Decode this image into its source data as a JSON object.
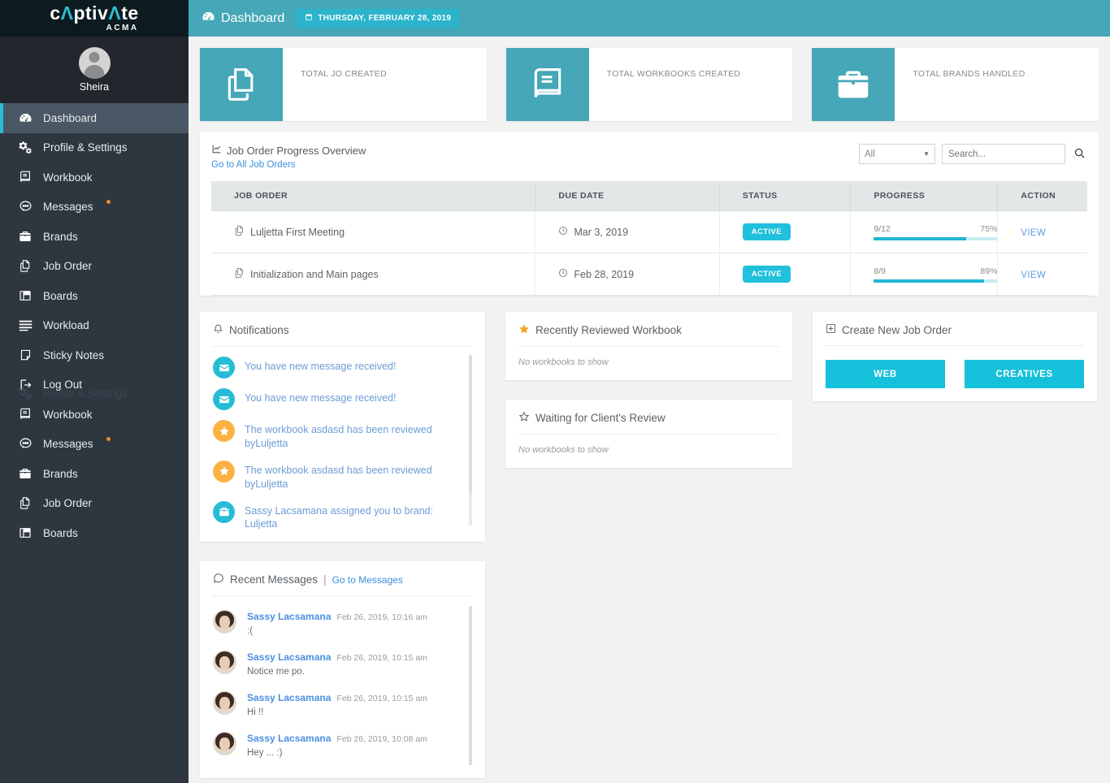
{
  "brand": {
    "name_part1": "c",
    "name_accent": "Ʌ",
    "name_part2": "ptiv",
    "name_accent2": "Ʌ",
    "name_part3": "te",
    "full": "captivate",
    "sub": "ACMA"
  },
  "profile": {
    "name": "Sheira"
  },
  "sidebar": {
    "items": [
      {
        "label": "Dashboard",
        "icon": "dashboard-icon",
        "active": true,
        "dot": false
      },
      {
        "label": "Profile & Settings",
        "icon": "gears-icon",
        "active": false,
        "dot": false
      },
      {
        "label": "Workbook",
        "icon": "book-icon",
        "active": false,
        "dot": false
      },
      {
        "label": "Messages",
        "icon": "chat-icon",
        "active": false,
        "dot": true
      },
      {
        "label": "Brands",
        "icon": "briefcase-icon",
        "active": false,
        "dot": false
      },
      {
        "label": "Job Order",
        "icon": "copy-icon",
        "active": false,
        "dot": false
      },
      {
        "label": "Boards",
        "icon": "columns-icon",
        "active": false,
        "dot": false
      },
      {
        "label": "Workload",
        "icon": "bars-icon",
        "active": false,
        "dot": false
      },
      {
        "label": "Sticky Notes",
        "icon": "note-icon",
        "active": false,
        "dot": false
      },
      {
        "label": "Log Out",
        "icon": "logout-icon",
        "active": false,
        "dot": false
      },
      {
        "label": "Workbook",
        "icon": "book-icon",
        "active": false,
        "dot": false
      },
      {
        "label": "Messages",
        "icon": "chat-icon",
        "active": false,
        "dot": true
      },
      {
        "label": "Brands",
        "icon": "briefcase-icon",
        "active": false,
        "dot": false
      },
      {
        "label": "Job Order",
        "icon": "copy-icon",
        "active": false,
        "dot": false
      },
      {
        "label": "Boards",
        "icon": "columns-icon",
        "active": false,
        "dot": false
      }
    ],
    "ghost_label": "Profile & Settings"
  },
  "topbar": {
    "title": "Dashboard",
    "title_icon": "dashboard-icon",
    "date": "THURSDAY, FEBRUARY 28, 2019",
    "date_icon": "calendar-icon"
  },
  "stats": [
    {
      "label": "TOTAL JO CREATED",
      "value": "",
      "icon": "copy-icon"
    },
    {
      "label": "TOTAL WORKBOOKS CREATED",
      "value": "",
      "icon": "book-icon"
    },
    {
      "label": "TOTAL BRANDS HANDLED",
      "value": "",
      "icon": "briefcase-icon"
    }
  ],
  "job_orders": {
    "title": "Job Order Progress Overview",
    "title_icon": "chart-line-icon",
    "link": "Go to All Job Orders",
    "filter_value": "All",
    "search_placeholder": "Search...",
    "search_value": "",
    "columns": [
      "JOB ORDER",
      "DUE DATE",
      "STATUS",
      "PROGRESS",
      "ACTION"
    ],
    "rows": [
      {
        "name": "Luljetta First Meeting",
        "due": "Mar 3, 2019",
        "status": "ACTIVE",
        "ratio": "9/12",
        "percent": "75%",
        "percent_num": 75,
        "action": "VIEW"
      },
      {
        "name": "Initialization and Main pages",
        "due": "Feb 28, 2019",
        "status": "ACTIVE",
        "ratio": "8/9",
        "percent": "89%",
        "percent_num": 89,
        "action": "VIEW"
      }
    ]
  },
  "notifications": {
    "title": "Notifications",
    "title_icon": "bell-icon",
    "items": [
      {
        "text": "You have new message received!",
        "icon": "envelope-icon",
        "style": "msg"
      },
      {
        "text": "You have new message received!",
        "icon": "envelope-icon",
        "style": "msg"
      },
      {
        "text": "The workbook asdasd has been reviewed byLuljetta",
        "icon": "star-icon",
        "style": "star"
      },
      {
        "text": "The workbook asdasd has been reviewed byLuljetta",
        "icon": "star-icon",
        "style": "star"
      },
      {
        "text": "Sassy Lacsamana assigned you to brand: Luljetta",
        "icon": "briefcase-icon",
        "style": "brand"
      }
    ]
  },
  "reviewed": {
    "title": "Recently Reviewed Workbook",
    "title_icon": "star-filled-icon",
    "empty": "No workbooks to show"
  },
  "waiting": {
    "title": "Waiting for Client's Review",
    "title_icon": "star-outline-icon",
    "empty": "No workbooks to show"
  },
  "create_jo": {
    "title": "Create New Job Order",
    "title_icon": "plus-square-icon",
    "buttons": [
      "WEB",
      "CREATIVES"
    ]
  },
  "recent_messages": {
    "title": "Recent Messages",
    "title_icon": "comment-icon",
    "separator": "|",
    "link": "Go to Messages",
    "items": [
      {
        "name": "Sassy Lacsamana",
        "time": "Feb 26, 2019, 10:16 am",
        "text": ":("
      },
      {
        "name": "Sassy Lacsamana",
        "time": "Feb 26, 2019, 10:15 am",
        "text": "Notice me po."
      },
      {
        "name": "Sassy Lacsamana",
        "time": "Feb 26, 2019, 10:15 am",
        "text": "Hi !!"
      },
      {
        "name": "Sassy Lacsamana",
        "time": "Feb 26, 2019, 10:08 am",
        "text": "Hey ... :)"
      }
    ]
  },
  "colors": {
    "topbar": "#45a7b8",
    "sidebar": "#2e3740",
    "sidebar_dark": "#21272c",
    "logo_bg": "#0d1b20",
    "accent_cyan": "#15c0da",
    "badge": "#21c0dc",
    "link_blue": "#3b8fe0",
    "star_orange": "#fcb242",
    "dot_orange": "#f08a24"
  }
}
